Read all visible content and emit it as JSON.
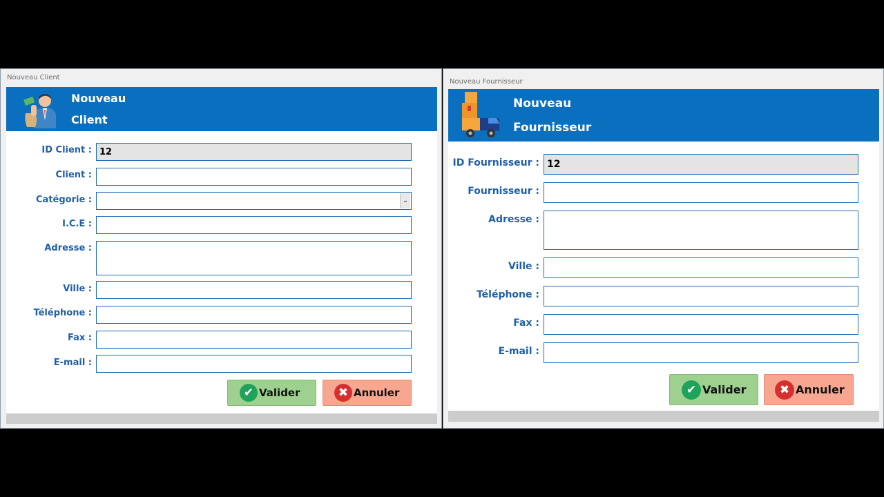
{
  "client": {
    "window_title": "Nouveau Client",
    "banner": {
      "line1": "Nouveau",
      "line2": "Client",
      "icon": "person-with-money-icon"
    },
    "fields": [
      {
        "label": "ID Client :",
        "value": "12"
      },
      {
        "label": "Client :",
        "value": ""
      },
      {
        "label": "Catégorie :",
        "value": ""
      },
      {
        "label": "I.C.E :",
        "value": ""
      },
      {
        "label": "Adresse :",
        "value": ""
      },
      {
        "label": "Ville :",
        "value": ""
      },
      {
        "label": "Téléphone :",
        "value": ""
      },
      {
        "label": "Fax :",
        "value": ""
      },
      {
        "label": "E-mail :",
        "value": ""
      }
    ],
    "buttons": {
      "validate": "Valider",
      "cancel": "Annuler"
    }
  },
  "supplier": {
    "window_title": "Nouveau Fournisseur",
    "banner": {
      "line1": "Nouveau",
      "line2": "Fournisseur",
      "icon": "delivery-truck-icon"
    },
    "fields": [
      {
        "label": "ID Fournisseur :",
        "value": "12"
      },
      {
        "label": "Fournisseur :",
        "value": ""
      },
      {
        "label": "Adresse :",
        "value": ""
      },
      {
        "label": "Ville :",
        "value": ""
      },
      {
        "label": "Téléphone :",
        "value": ""
      },
      {
        "label": "Fax :",
        "value": ""
      },
      {
        "label": "E-mail :",
        "value": ""
      }
    ],
    "buttons": {
      "validate": "Valider",
      "cancel": "Annuler"
    }
  },
  "colors": {
    "banner": "#0a6fbf",
    "label": "#1f5fa8",
    "field_border": "#1e6bb0",
    "ok": "#9ed18f",
    "cancel": "#f7a78f"
  }
}
